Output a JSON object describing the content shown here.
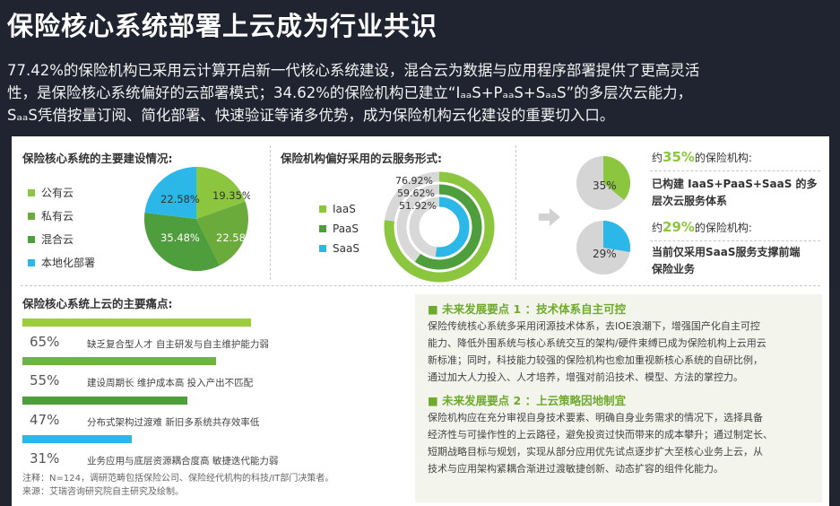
{
  "header": {
    "title": "保险核心系统部署上云成为行业共识",
    "intro_line1": "77.42%的保险机构已采用云计算开启新一代核心系统建设，混合云为数据与应用程序部署提供了更高灵活",
    "intro_line2": "性，是保险核心系统偏好的云部署模式；34.62%的保险机构已建立“IₐₐS+PₐₐS+SₐₐS”的多层次云能力，",
    "intro_line3": "SₐₐS凭借按量订阅、简化部署、快速验证等诸多优势，成为保险机构云化建设的重要切入口。"
  },
  "construction": {
    "title": "保险核心系统的主要建设情况:",
    "legend": [
      "公有云",
      "私有云",
      "混合云",
      "本地化部署"
    ],
    "colors": [
      "#8cc63f",
      "#6aab3b",
      "#4f9e3e",
      "#2bb7e8"
    ],
    "pie_labels": [
      "19.35%",
      "22.58%",
      "35.48%",
      "22.58%"
    ]
  },
  "services": {
    "title": "保险机构偏好采用的云服务形式:",
    "legend": [
      "IaaS",
      "PaaS",
      "SaaS"
    ],
    "ring_labels": [
      "76.92%",
      "59.62%",
      "51.92%"
    ]
  },
  "right": {
    "stat1_prefix": "约",
    "stat1_pct": "35%",
    "stat1_suffix": "的保险机构:",
    "stat1_desc_line1": "已构建 IaaS+PaaS+SaaS 的多",
    "stat1_desc_line2": "层次云服务体系",
    "stat1_pie": "35%",
    "stat2_prefix": "约",
    "stat2_pct": "29%",
    "stat2_suffix": "的保险机构:",
    "stat2_desc_line1": "当前仅采用SaaS服务支撑前端",
    "stat2_desc_line2": "保险业务",
    "stat2_pie": "29%"
  },
  "pain": {
    "title": "保险核心系统上云的主要痛点:",
    "items": [
      {
        "pct": "65%",
        "text": "缺乏复合型人才  自主研发与自主维护能力弱",
        "value": 65,
        "color": "#9ccd3c"
      },
      {
        "pct": "55%",
        "text": "建设周期长  维护成本高  投入产出不匹配",
        "value": 55,
        "color": "#6fb443"
      },
      {
        "pct": "47%",
        "text": "分布式架构过渡难  新旧多系统共存效率低",
        "value": 47,
        "color": "#4f9e3e"
      },
      {
        "pct": "31%",
        "text": "业务应用与底层资源耦合度高  敏捷迭代能力弱",
        "value": 31,
        "color": "#2bb7e8"
      }
    ],
    "note1": "注释：N=124，调研范畴包括保险公司、保险经代机构的科技/IT部门决策者。",
    "note2": "来源：艾瑞咨询研究院自主研究及绘制。"
  },
  "future": {
    "head1": "■  未来发展要点 1 ：技术体系自主可控",
    "body1": [
      "保险传统核心系统多采用闭源技术体系，去IOE浪潮下，增强国产化自主可控",
      "能力、降低外围系统与核心系统交互的架构/硬件束缚已成为保险机构上云用云",
      "新标准；同时，科技能力较强的保险机构也愈加重视新核心系统的自研比例，",
      "通过加大人力投入、人才培养，增强对前沿技术、模型、方法的掌控力。"
    ],
    "head2": "■  未来发展要点 2 ：上云策略因地制宜",
    "body2": [
      "保险机构应在充分审视自身技术要素、明确自身业务需求的情况下，选择具备",
      "经济性与可操作性的上云路径，避免投资过快而带来的成本攀升；通过制定长、",
      "短期战略目标与规划，实现从部分应用优先试点逐步扩大至核心业务上云，从",
      "技术与应用架构紧耦合渐进过渡敏捷创新、动态扩容的组件化能力。"
    ]
  }
}
